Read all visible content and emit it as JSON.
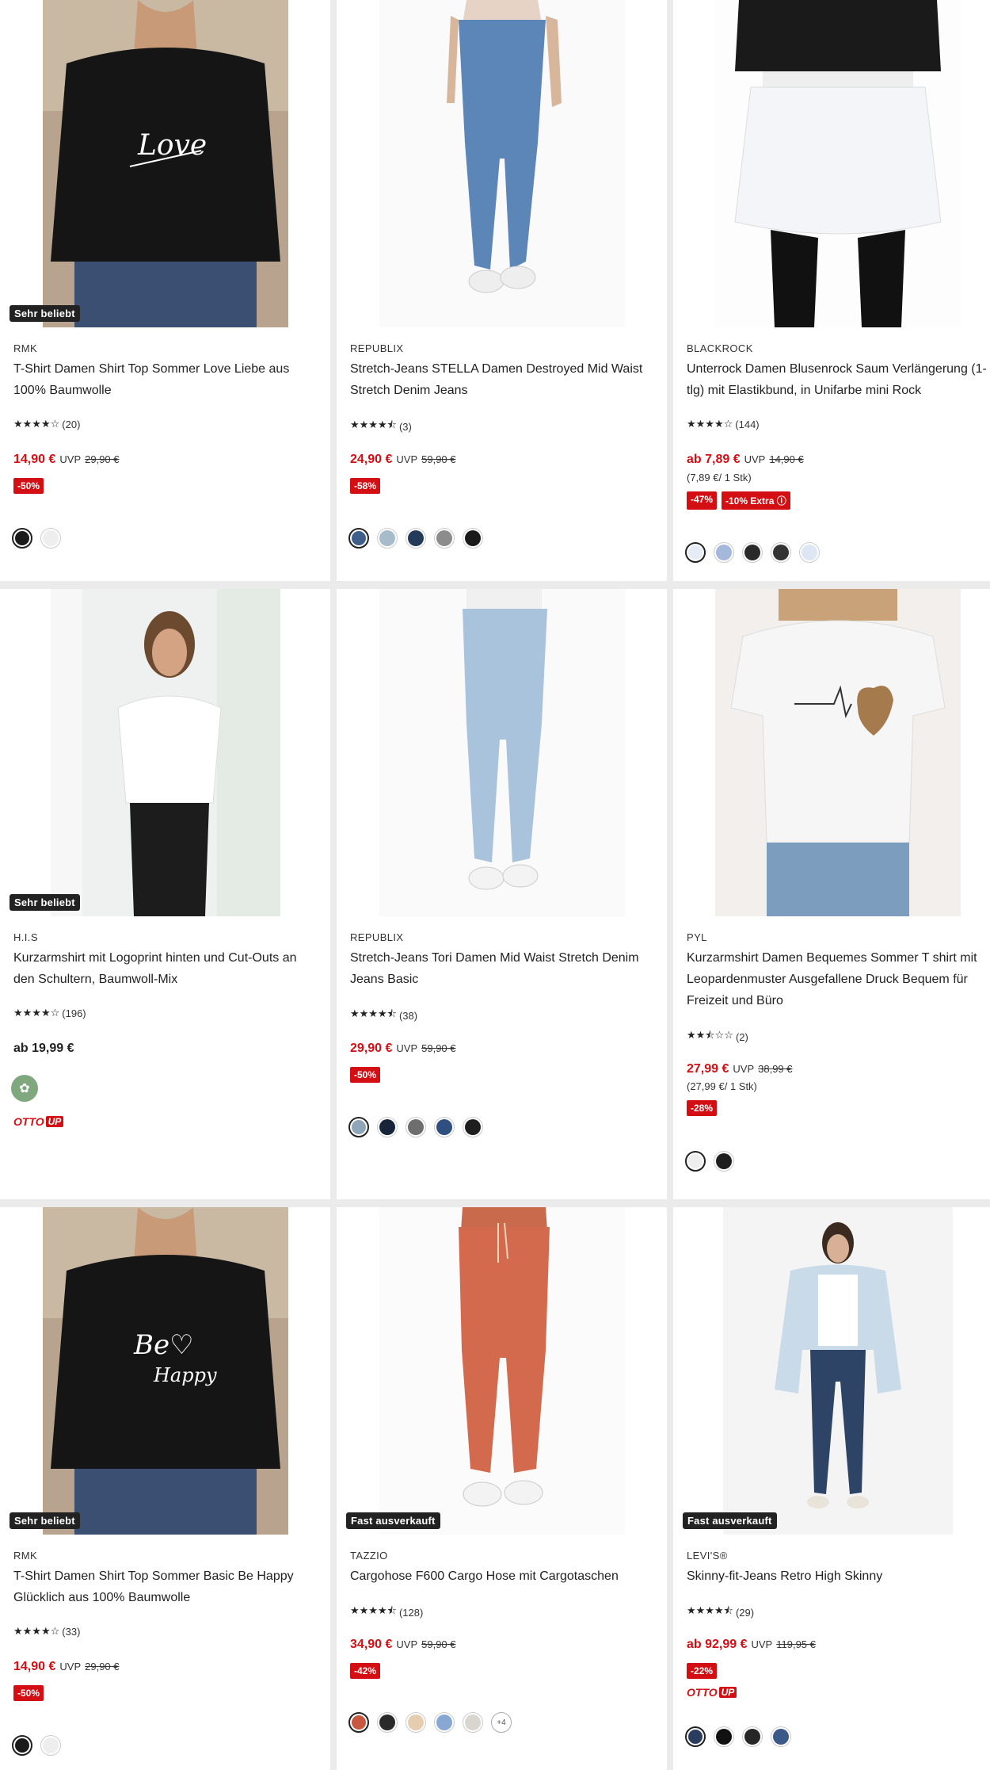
{
  "products": [
    {
      "badge": "Sehr beliebt",
      "brand": "RMK",
      "title": "T-Shirt Damen Shirt Top Sommer Love Liebe aus 100% Baumwolle",
      "stars": "★★★★☆",
      "reviews": "(20)",
      "price": "14,90 €",
      "uvp_label": "UVP",
      "uvp": "29,90 €",
      "discount": "-50%",
      "swatches": [
        "#1a1a1a",
        "#eeeeee"
      ]
    },
    {
      "badge": "",
      "brand": "REPUBLIX",
      "title": "Stretch-Jeans STELLA Damen Destroyed Mid Waist Stretch Denim Jeans",
      "stars": "★★★★⯪",
      "reviews": "(3)",
      "price": "24,90 €",
      "uvp_label": "UVP",
      "uvp": "59,90 €",
      "discount": "-58%",
      "swatches": [
        "#3f5f8a",
        "#a7bccb",
        "#243a5a",
        "#8c8c8c",
        "#1a1a1a"
      ]
    },
    {
      "badge": "",
      "brand": "BLACKROCK",
      "title": "Unterrock Damen Blusenrock Saum Verlängerung (1-tlg) mit Elastikbund, in Unifarbe mini Rock",
      "stars": "★★★★☆",
      "reviews": "(144)",
      "price": "ab 7,89 €",
      "uvp_label": "UVP",
      "uvp": "14,90 €",
      "unit": "(7,89 €/ 1 Stk)",
      "discount": "-47%",
      "extra": "-10% Extra ⓘ",
      "swatches": [
        "#e6ecf5",
        "#a4b8dc",
        "#2a2a2a",
        "#333333",
        "#dde6f3"
      ]
    },
    {
      "badge": "Sehr beliebt",
      "brand": "H.I.S",
      "title": "Kurzarmshirt mit Logoprint hinten und Cut-Outs an den Schultern, Baumwoll-Mix",
      "stars": "★★★★☆",
      "reviews": "(196)",
      "price": "ab 19,99 €",
      "ottoup": "OTTO",
      "ottoup_box": "UP",
      "sust_icon": "leaf-network-icon"
    },
    {
      "badge": "",
      "brand": "REPUBLIX",
      "title": "Stretch-Jeans Tori Damen Mid Waist Stretch Denim Jeans Basic",
      "stars": "★★★★⯪",
      "reviews": "(38)",
      "price": "29,90 €",
      "uvp_label": "UVP",
      "uvp": "59,90 €",
      "discount": "-50%",
      "swatches": [
        "#8fa6b8",
        "#18243a",
        "#6e6e6e",
        "#2e4f7f",
        "#1e1e1e"
      ]
    },
    {
      "badge": "",
      "brand": "PYL",
      "title": "Kurzarmshirt Damen Bequemes Sommer T shirt mit Leopardenmuster Ausgefallene Druck Bequem für Freizeit und Büro",
      "stars": "★★⯪☆☆",
      "reviews": "(2)",
      "price": "27,99 €",
      "uvp_label": "UVP",
      "uvp": "38,99 €",
      "unit": "(27,99 €/ 1 Stk)",
      "discount": "-28%",
      "swatches": [
        "#eeeeee",
        "#1e1e1e"
      ]
    },
    {
      "badge": "Sehr beliebt",
      "brand": "RMK",
      "title": "T-Shirt Damen Shirt Top Sommer Basic Be Happy Glücklich aus 100% Baumwolle",
      "stars": "★★★★☆",
      "reviews": "(33)",
      "price": "14,90 €",
      "uvp_label": "UVP",
      "uvp": "29,90 €",
      "discount": "-50%",
      "swatches": [
        "#1a1a1a",
        "#eeeeee"
      ]
    },
    {
      "badge": "Fast ausverkauft",
      "brand": "TAZZIO",
      "title": "Cargohose F600 Cargo Hose mit Cargotaschen",
      "stars": "★★★★⯪",
      "reviews": "(128)",
      "price": "34,90 €",
      "uvp_label": "UVP",
      "uvp": "59,90 €",
      "discount": "-42%",
      "swatches": [
        "#c8573f",
        "#2a2a2a",
        "#e6cdb0",
        "#88a7d2",
        "#d9d6d0"
      ],
      "more": "+4"
    },
    {
      "badge": "Fast ausverkauft",
      "brand": "LEVI'S®",
      "title": "Skinny-fit-Jeans Retro High Skinny",
      "stars": "★★★★⯪",
      "reviews": "(29)",
      "price": "ab 92,99 €",
      "uvp_label": "UVP",
      "uvp": "119,95 €",
      "discount": "-22%",
      "ottoup": "OTTO",
      "ottoup_box": "UP",
      "swatches": [
        "#2b3d5e",
        "#111111",
        "#262626",
        "#3a5888"
      ]
    }
  ]
}
